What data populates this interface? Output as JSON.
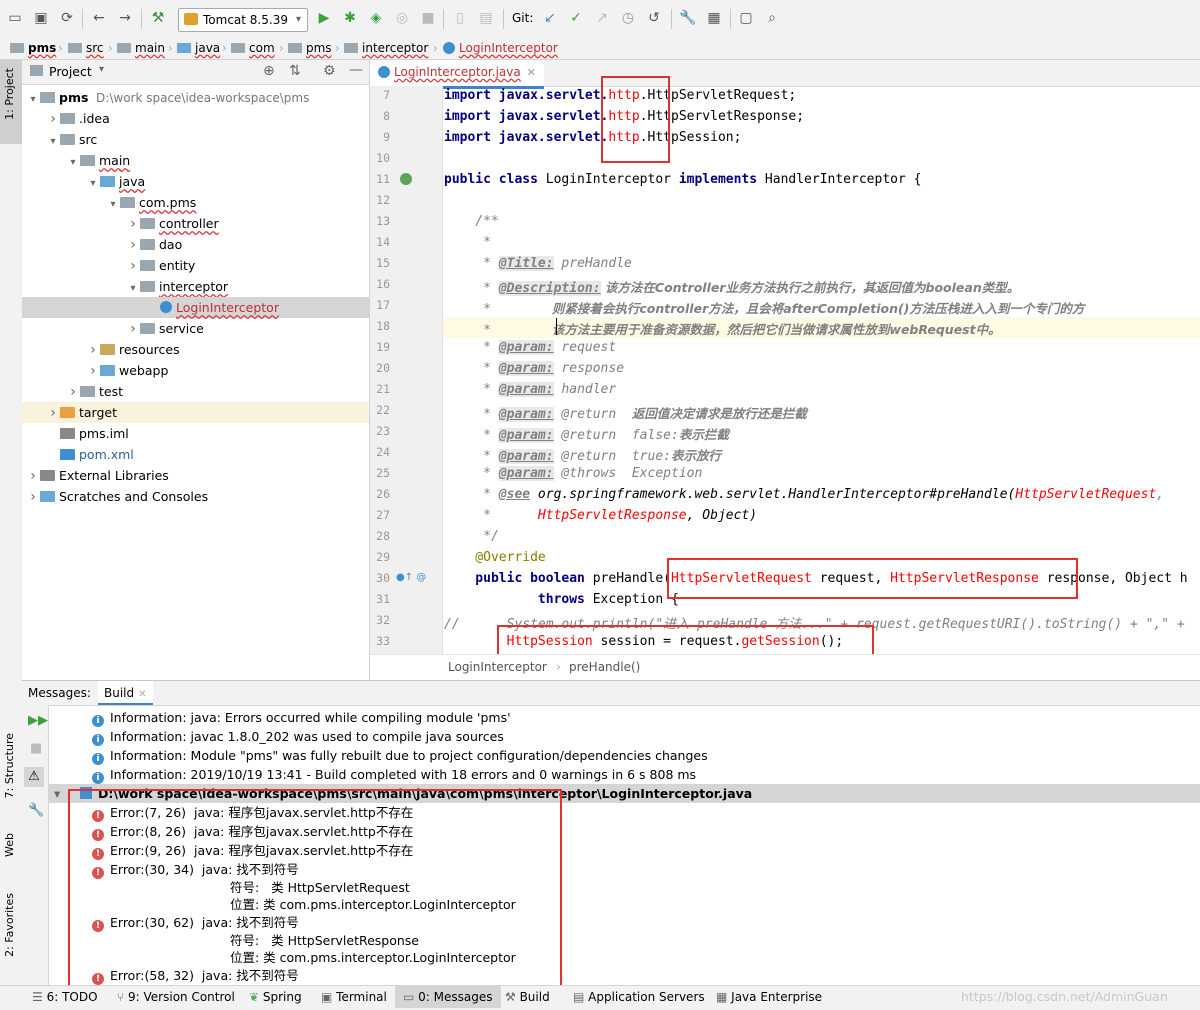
{
  "toolbar": {
    "run_config": "Tomcat 8.5.39",
    "git_label": "Git:"
  },
  "breadcrumb": [
    "pms",
    "src",
    "main",
    "java",
    "com",
    "pms",
    "interceptor",
    "LoginInterceptor"
  ],
  "project_panel": {
    "title": "Project",
    "tree": [
      {
        "label": "pms",
        "extra": "D:\\work space\\idea-workspace\\pms",
        "depth": 0,
        "arrow": "open",
        "icon": "folder"
      },
      {
        "label": ".idea",
        "depth": 1,
        "arrow": "closed",
        "icon": "folder"
      },
      {
        "label": "src",
        "depth": 1,
        "arrow": "open",
        "icon": "folder"
      },
      {
        "label": "main",
        "depth": 2,
        "arrow": "open",
        "icon": "folder"
      },
      {
        "label": "java",
        "depth": 3,
        "arrow": "open",
        "icon": "srcfolder"
      },
      {
        "label": "com.pms",
        "depth": 4,
        "arrow": "open",
        "icon": "package"
      },
      {
        "label": "controller",
        "depth": 5,
        "arrow": "closed",
        "icon": "package"
      },
      {
        "label": "dao",
        "depth": 5,
        "arrow": "closed",
        "icon": "package"
      },
      {
        "label": "entity",
        "depth": 5,
        "arrow": "closed",
        "icon": "package"
      },
      {
        "label": "interceptor",
        "depth": 5,
        "arrow": "open",
        "icon": "package"
      },
      {
        "label": "LoginInterceptor",
        "depth": 6,
        "arrow": "none",
        "icon": "class",
        "selected": true
      },
      {
        "label": "service",
        "depth": 5,
        "arrow": "closed",
        "icon": "package"
      },
      {
        "label": "resources",
        "depth": 3,
        "arrow": "closed",
        "icon": "resfolder"
      },
      {
        "label": "webapp",
        "depth": 3,
        "arrow": "closed",
        "icon": "webfolder"
      },
      {
        "label": "test",
        "depth": 2,
        "arrow": "closed",
        "icon": "folder"
      },
      {
        "label": "target",
        "depth": 1,
        "arrow": "closed",
        "icon": "orangefolder",
        "highlight": true
      },
      {
        "label": "pms.iml",
        "depth": 1,
        "arrow": "none",
        "icon": "iml"
      },
      {
        "label": "pom.xml",
        "depth": 1,
        "arrow": "none",
        "icon": "maven"
      },
      {
        "label": "External Libraries",
        "depth": 0,
        "arrow": "closed",
        "icon": "libs"
      },
      {
        "label": "Scratches and Consoles",
        "depth": 0,
        "arrow": "closed",
        "icon": "scratch"
      }
    ]
  },
  "editor": {
    "tab": "LoginInterceptor.java",
    "crumbs": [
      "LoginInterceptor",
      "preHandle()"
    ],
    "lines": [
      "7",
      "8",
      "9",
      "10",
      "11",
      "12",
      "13",
      "14",
      "15",
      "16",
      "17",
      "18",
      "19",
      "20",
      "21",
      "22",
      "23",
      "24",
      "25",
      "26",
      "27",
      "28",
      "29",
      "30",
      "31",
      "32",
      "33"
    ],
    "code": {
      "l7a": "import javax.servlet.",
      "l7b": "http",
      "l7c": ".HttpServletRequest;",
      "l8a": "import javax.servlet.",
      "l8b": "http",
      "l8c": ".HttpServletResponse;",
      "l9a": "import javax.servlet.",
      "l9b": "http",
      "l9c": ".HttpSession;",
      "l11a": "public class",
      "l11b": " LoginInterceptor ",
      "l11c": "implements",
      "l11d": " HandlerInterceptor {",
      "l13": "    /**",
      "l14": "     *",
      "l15a": "     * ",
      "l15b": "@Title:",
      "l15c": " preHandle",
      "l16a": "     * ",
      "l16b": "@Description:",
      "l16c": " 该方法在Controller业务方法执行之前执行，其返回值为boolean类型。",
      "l17a": "     *",
      "l17b": "              则紧接着会执行controller方法，且会将afterCompletion()方法压栈进入入到一个专门的方",
      "l18a": "     *",
      "l18b": "              该方法主要用于准备资源数据，然后把它们当做请求属性放到webRequest中。",
      "l19a": "     * ",
      "l19b": "@param:",
      "l19c": " request",
      "l20a": "     * ",
      "l20b": "@param:",
      "l20c": " response",
      "l21a": "     * ",
      "l21b": "@param:",
      "l21c": " handler",
      "l22a": "     * ",
      "l22b": "@param:",
      "l22c": " @return  ",
      "l22d": "返回值决定请求是放行还是拦截",
      "l23a": "     * ",
      "l23b": "@param:",
      "l23c": " @return  false:",
      "l23d": "表示拦截",
      "l24a": "     * ",
      "l24b": "@param:",
      "l24c": " @return  true:",
      "l24d": "表示放行",
      "l25a": "     * ",
      "l25b": "@param:",
      "l25c": " @throws  Exception",
      "l26a": "     * ",
      "l26b": "@see",
      "l26c": " org.springframework.web.servlet.HandlerInterceptor#preHandle(",
      "l26d": "HttpServletRequest",
      "l26e": ",",
      "l27a": "     *      ",
      "l27b": "HttpServletResponse",
      "l27c": ", Object)",
      "l28": "     */",
      "l29": "    @Override",
      "l30a": "    public boolean",
      "l30b": " preHandle(",
      "l30c": "HttpServletRequest",
      "l30d": " request, ",
      "l30e": "HttpServletResponse",
      "l30f": " response, Object h",
      "l31a": "            ",
      "l31b": "throws",
      "l31c": " Exception {",
      "l32": "//      System.out.println(\"进入 preHandle 方法...\" + request.getRequestURI().toString() + \",\" +",
      "l33a": "        ",
      "l33b": "HttpSession",
      "l33c": " session = request.",
      "l33d": "getSession",
      "l33e": "();"
    }
  },
  "messages": {
    "label": "Messages:",
    "build_tab": "Build",
    "rows": [
      {
        "kind": "info",
        "text": "Information: java: Errors occurred while compiling module 'pms'"
      },
      {
        "kind": "info",
        "text": "Information: javac 1.8.0_202 was used to compile java sources"
      },
      {
        "kind": "info",
        "text": "Information: Module \"pms\" was fully rebuilt due to project configuration/dependencies changes"
      },
      {
        "kind": "info",
        "text": "Information: 2019/10/19 13:41 - Build completed with 18 errors and 0 warnings in 6 s 808 ms"
      },
      {
        "kind": "file",
        "text": "D:\\work space\\idea-workspace\\pms\\src\\main\\java\\com\\pms\\interceptor\\LoginInterceptor.java"
      },
      {
        "kind": "error",
        "text": "Error:(7, 26)  java: 程序包javax.servlet.http不存在"
      },
      {
        "kind": "error",
        "text": "Error:(8, 26)  java: 程序包javax.servlet.http不存在"
      },
      {
        "kind": "error",
        "text": "Error:(9, 26)  java: 程序包javax.servlet.http不存在"
      },
      {
        "kind": "error",
        "text": "Error:(30, 34)  java: 找不到符号"
      },
      {
        "kind": "detail",
        "text": "符号:   类 HttpServletRequest"
      },
      {
        "kind": "detail",
        "text": "位置: 类 com.pms.interceptor.LoginInterceptor"
      },
      {
        "kind": "error",
        "text": "Error:(30, 62)  java: 找不到符号"
      },
      {
        "kind": "detail",
        "text": "符号:   类 HttpServletResponse"
      },
      {
        "kind": "detail",
        "text": "位置: 类 com.pms.interceptor.LoginInterceptor"
      },
      {
        "kind": "error",
        "text": "Error:(58, 32)  java: 找不到符号"
      }
    ]
  },
  "left_tabs": [
    "1: Project",
    "7: Structure",
    "Web",
    "2: Favorites"
  ],
  "statusbar": {
    "items": [
      "6: TODO",
      "9: Version Control",
      "Spring",
      "Terminal",
      "0: Messages",
      "Build",
      "Application Servers",
      "Java Enterprise"
    ],
    "watermark": "https://blog.csdn.net/AdminGuan"
  },
  "colors": {
    "accent": "#4083c9",
    "highlight_box": "#e03030",
    "selection": "#d5d5d5",
    "error_text": "#ff0000"
  }
}
